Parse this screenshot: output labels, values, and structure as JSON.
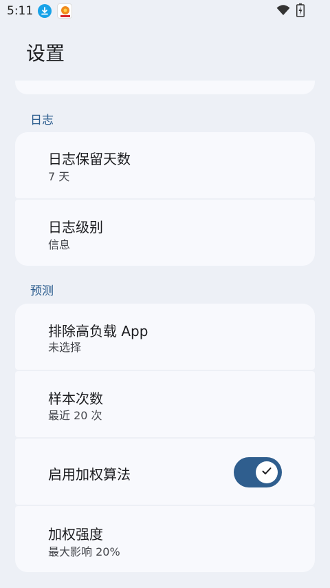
{
  "status_bar": {
    "time": "5:11"
  },
  "header": {
    "title": "设置"
  },
  "sections": [
    {
      "header": "日志",
      "items": [
        {
          "title": "日志保留天数",
          "summary": "7 天"
        },
        {
          "title": "日志级别",
          "summary": "信息"
        }
      ]
    },
    {
      "header": "预测",
      "items": [
        {
          "title": "排除高负载 App",
          "summary": "未选择"
        },
        {
          "title": "样本次数",
          "summary": "最近 20 次"
        },
        {
          "title": "启用加权算法",
          "toggle": "on"
        },
        {
          "title": "加权强度",
          "summary": "最大影响 20%"
        }
      ]
    }
  ],
  "colors": {
    "accent": "#2f5e8e",
    "section_header": "#2d5e8f",
    "background": "#edf0f6",
    "card": "#f8f9fd"
  },
  "icons": [
    "download-icon",
    "app-notification-icon",
    "wifi-icon",
    "battery-icon",
    "check-icon"
  ]
}
